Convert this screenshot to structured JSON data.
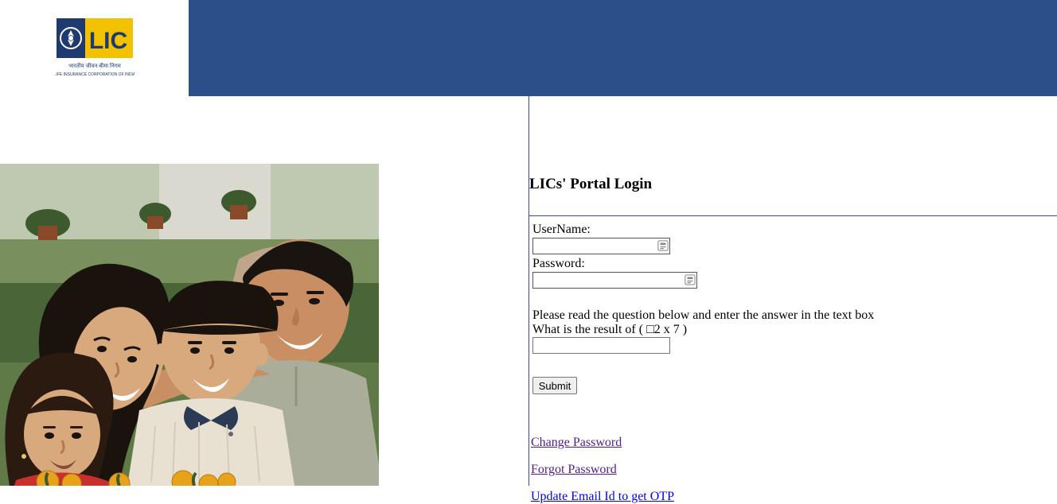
{
  "logo": {
    "text_main": "LIC",
    "tagline_hi": "भारतीय जीवन बीमा निगम",
    "tagline_en": "LIFE INSURANCE CORPORATION OF INDIA"
  },
  "login": {
    "title": "LICs' Portal Login",
    "username_label": "UserName:",
    "username_value": "",
    "password_label": "Password:",
    "password_value": "",
    "captcha_intro": "Please read the question below and enter the answer in the text box",
    "captcha_question": "What is the result of ( □2 x 7 )",
    "captcha_value": "",
    "submit_label": "Submit"
  },
  "links": {
    "change_password": "Change Password",
    "forgot_password": "Forgot Password",
    "update_email": "Update Email Id to get OTP"
  }
}
